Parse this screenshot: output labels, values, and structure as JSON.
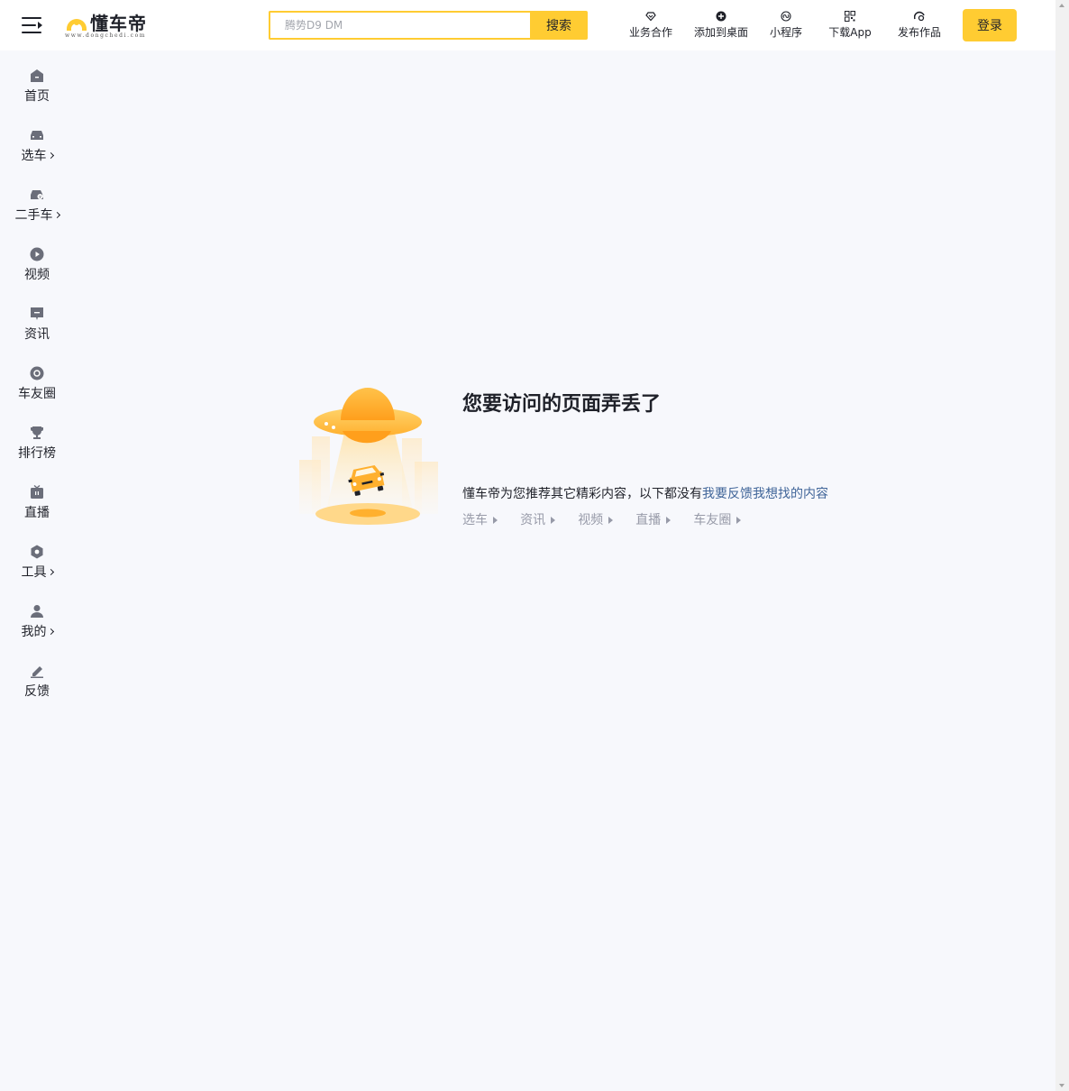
{
  "header": {
    "logo_text": "懂车帝",
    "logo_sub": "www.dongchedi.com",
    "search_placeholder": "腾势D9 DM",
    "search_button": "搜索",
    "nav": [
      {
        "label": "业务合作",
        "icon": "diamond-icon"
      },
      {
        "label": "添加到桌面",
        "icon": "plus-circle-icon"
      },
      {
        "label": "小程序",
        "icon": "mini-program-icon"
      },
      {
        "label": "下载App",
        "icon": "qr-code-icon"
      },
      {
        "label": "发布作品",
        "icon": "publish-icon"
      }
    ],
    "login": "登录"
  },
  "sidebar": {
    "items": [
      {
        "label": "首页",
        "icon": "home-icon",
        "has_arrow": false
      },
      {
        "label": "选车",
        "icon": "car-icon",
        "has_arrow": true
      },
      {
        "label": "二手车",
        "icon": "used-car-icon",
        "has_arrow": true
      },
      {
        "label": "视频",
        "icon": "play-icon",
        "has_arrow": false
      },
      {
        "label": "资讯",
        "icon": "news-icon",
        "has_arrow": false
      },
      {
        "label": "车友圈",
        "icon": "community-icon",
        "has_arrow": false
      },
      {
        "label": "排行榜",
        "icon": "trophy-icon",
        "has_arrow": false
      },
      {
        "label": "直播",
        "icon": "live-icon",
        "has_arrow": false
      },
      {
        "label": "工具",
        "icon": "tool-icon",
        "has_arrow": true
      },
      {
        "label": "我的",
        "icon": "user-icon",
        "has_arrow": true
      },
      {
        "label": "反馈",
        "icon": "feedback-icon",
        "has_arrow": false
      }
    ]
  },
  "error": {
    "title": "您要访问的页面弄丢了",
    "desc_prefix": "懂车帝为您推荐其它精彩内容，以下都没有",
    "desc_link": "我要反馈我想找的内容",
    "links": [
      "选车",
      "资讯",
      "视频",
      "直播",
      "车友圈"
    ]
  },
  "colors": {
    "accent": "#ffcc32",
    "link": "#406599",
    "muted": "#979aa8",
    "background": "#f7f8fc",
    "icon_gray": "#6b6e7a"
  }
}
